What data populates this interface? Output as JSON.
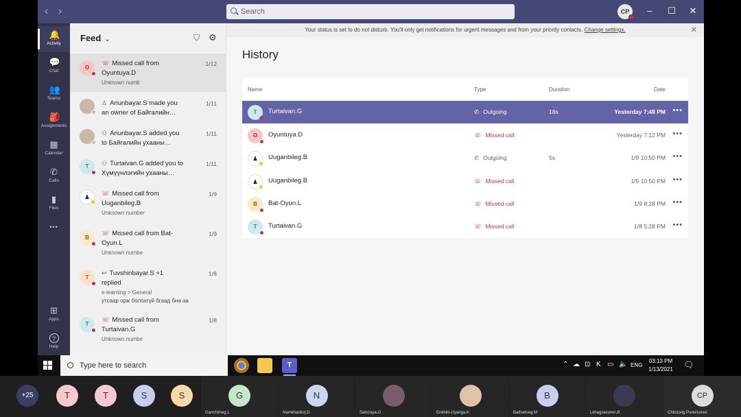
{
  "window": {
    "search_placeholder": "Search",
    "user_initials": "CP",
    "controls": {
      "minimize": "–",
      "maximize": "☐",
      "close": "✕"
    }
  },
  "rail": {
    "items": [
      {
        "label": "Activity",
        "icon": "bell-icon",
        "glyph": "🔔"
      },
      {
        "label": "Chat",
        "icon": "chat-icon",
        "glyph": "💬"
      },
      {
        "label": "Teams",
        "icon": "teams-icon",
        "glyph": "👥"
      },
      {
        "label": "Assignments",
        "icon": "assignments-icon",
        "glyph": "🎒"
      },
      {
        "label": "Calendar",
        "icon": "calendar-icon",
        "glyph": "▦"
      },
      {
        "label": "Calls",
        "icon": "phone-icon",
        "glyph": "✆"
      },
      {
        "label": "Files",
        "icon": "files-icon",
        "glyph": "▮"
      },
      {
        "label": "",
        "icon": "more-icon",
        "glyph": "•••"
      },
      {
        "label": "Apps",
        "icon": "apps-icon",
        "glyph": "⊞"
      },
      {
        "label": "Help",
        "icon": "help-icon",
        "glyph": "?"
      }
    ]
  },
  "feed": {
    "title": "Feed",
    "items": [
      {
        "initial": "O",
        "line1": "Missed call from",
        "line2": "Oyuntuya.D",
        "sub": "Unknown numb",
        "date": "1/12"
      },
      {
        "initial": "",
        "line1": "Ariunbayar.S made you",
        "line2": "an owner of Байгалийн…",
        "sub": "",
        "date": "1/11"
      },
      {
        "initial": "",
        "line1": "Ariunbayar.S added you",
        "line2": "to Байгалийн ухааны…",
        "sub": "",
        "date": "1/11"
      },
      {
        "initial": "T",
        "line1": "Turtaivan.G added you to",
        "line2": "Хүмүүнлэгийн ухааны…",
        "sub": "",
        "date": "1/11"
      },
      {
        "initial": "",
        "line1": "Missed call from",
        "line2": "Uuganbileg.B",
        "sub": "Unknown number",
        "date": "1/9"
      },
      {
        "initial": "B",
        "line1": "Missed call from Bat-",
        "line2": "Oyun.L",
        "sub": "Unknown numbe",
        "date": "1/9"
      },
      {
        "initial": "T",
        "line1": "Tuvshinbayar.S +1",
        "line2": "replied",
        "sub": "e-learning > General",
        "sub2": "утсаар орж болохгүй бгаад бна аа",
        "date": "1/8"
      },
      {
        "initial": "T",
        "line1": "Missed call from",
        "line2": "Turtaivan.G",
        "sub": "Unknown numbe",
        "date": "1/8"
      }
    ]
  },
  "banner": {
    "text": "Your status is set to do not disturb. You'll only get notifications for urgent messages and from your priority contacts.",
    "link": "Change settings."
  },
  "history": {
    "title": "History",
    "headers": {
      "name": "Name",
      "type": "Type",
      "duration": "Duration",
      "date": "Date"
    },
    "rows": [
      {
        "initial": "T",
        "name": "Turtaivan.G",
        "type": "Outgoing",
        "duration": "18s",
        "date": "Yesterday 7:48 PM"
      },
      {
        "initial": "O",
        "name": "Oyuntuya.D",
        "type": "Missed call",
        "duration": "",
        "date": "Yesterday 7:12 PM"
      },
      {
        "initial": "",
        "name": "Uuganbileg.B",
        "type": "Outgoing",
        "duration": "5s",
        "date": "1/9 10:50 PM"
      },
      {
        "initial": "",
        "name": "Uuganbileg.B",
        "type": "Missed call",
        "duration": "",
        "date": "1/9 10:50 PM"
      },
      {
        "initial": "B",
        "name": "Bat-Oyun.L",
        "type": "Missed call",
        "duration": "",
        "date": "1/9 8:28 PM"
      },
      {
        "initial": "T",
        "name": "Turtaivan.G",
        "type": "Missed call",
        "duration": "",
        "date": "1/8 5:28 PM"
      }
    ]
  },
  "taskbar": {
    "search_placeholder": "Type here to search",
    "language": "ENG",
    "time": "03:13 PM",
    "date": "1/13/2021"
  },
  "meeting": {
    "overflow": "+25",
    "tiles": [
      {
        "initial": "T",
        "name": ""
      },
      {
        "initial": "T",
        "name": ""
      },
      {
        "initial": "S",
        "name": ""
      },
      {
        "initial": "S",
        "name": ""
      },
      {
        "initial": "G",
        "name": "Ganchimeg.L"
      },
      {
        "initial": "N",
        "name": "Namkhaidorj.D"
      },
      {
        "initial": "",
        "name": "Sainzaya.O"
      },
      {
        "initial": "",
        "name": "Enkhiin-Uyanga.K"
      },
      {
        "initial": "B",
        "name": "Battsetseg.M"
      },
      {
        "initial": "",
        "name": "Lkhagvasuren.B"
      },
      {
        "initial": "CP",
        "name": "Chinzorig Purevsuren"
      }
    ]
  },
  "colors": {
    "titlebar": "#464775",
    "rail": "#33344a",
    "accent": "#6264a7",
    "missed": "#c4314b"
  }
}
